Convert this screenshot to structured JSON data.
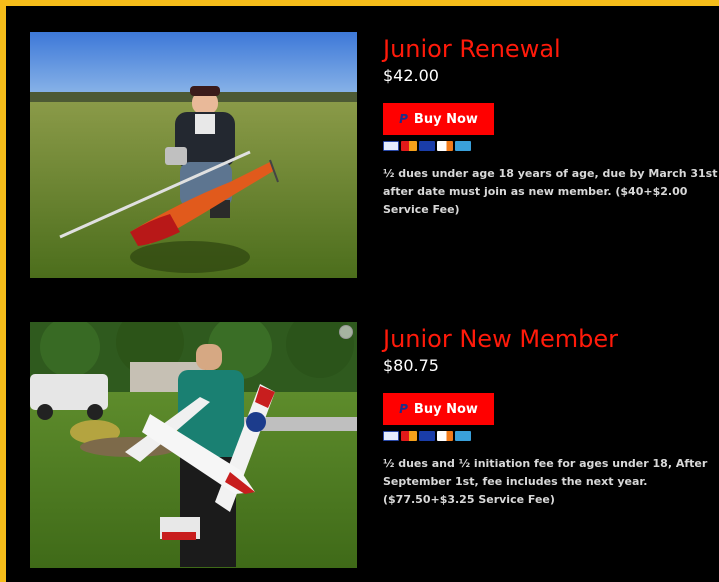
{
  "products": [
    {
      "title": "Junior Renewal",
      "price": "$42.00",
      "buy_label": "Buy Now",
      "paypal_mark": "P",
      "description": "½ dues under age 18 years of age, due by March 31st after date must join as new member. ($40+$2.00 Service Fee)",
      "photo_icon": "helicopter-photo"
    },
    {
      "title": "Junior New Member",
      "price": "$80.75",
      "buy_label": "Buy Now",
      "paypal_mark": "P",
      "description": "½ dues and ½ initiation fee for ages under 18, After September 1st, fee includes the next year. ($77.50+$3.25 Service Fee)",
      "photo_icon": "airplane-photo"
    }
  ],
  "colors": {
    "accent_title": "#ff1a0a",
    "button": "#ff0000",
    "border": "#f6bd1a",
    "background": "#000000"
  },
  "card_icons": [
    "paypal-icon",
    "mastercard-icon",
    "visa-icon",
    "discover-icon",
    "amex-icon"
  ]
}
